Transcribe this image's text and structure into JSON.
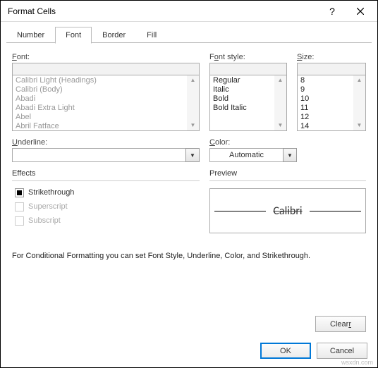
{
  "window": {
    "title": "Format Cells"
  },
  "tabs": [
    "Number",
    "Font",
    "Border",
    "Fill"
  ],
  "active_tab": 1,
  "font": {
    "label": "Font:",
    "value": "",
    "options": [
      "Calibri Light (Headings)",
      "Calibri (Body)",
      "Abadi",
      "Abadi Extra Light",
      "Abel",
      "Abril Fatface"
    ]
  },
  "fontstyle": {
    "label": "Font style:",
    "value": "",
    "options": [
      "Regular",
      "Italic",
      "Bold",
      "Bold Italic"
    ]
  },
  "size": {
    "label": "Size:",
    "value": "",
    "options": [
      "8",
      "9",
      "10",
      "11",
      "12",
      "14"
    ]
  },
  "underline": {
    "label": "Underline:",
    "value": ""
  },
  "color": {
    "label": "Color:",
    "value": "Automatic"
  },
  "effects": {
    "label": "Effects",
    "items": [
      {
        "label": "Strikethrough",
        "key": "strikethrough",
        "checked": true,
        "enabled": true
      },
      {
        "label": "Superscript",
        "key": "superscript",
        "checked": false,
        "enabled": false
      },
      {
        "label": "Subscript",
        "key": "subscript",
        "checked": false,
        "enabled": false
      }
    ]
  },
  "preview": {
    "label": "Preview",
    "text": "Calibri"
  },
  "note": "For Conditional Formatting you can set Font Style, Underline, Color, and Strikethrough.",
  "buttons": {
    "clear": "Clear",
    "ok": "OK",
    "cancel": "Cancel"
  }
}
